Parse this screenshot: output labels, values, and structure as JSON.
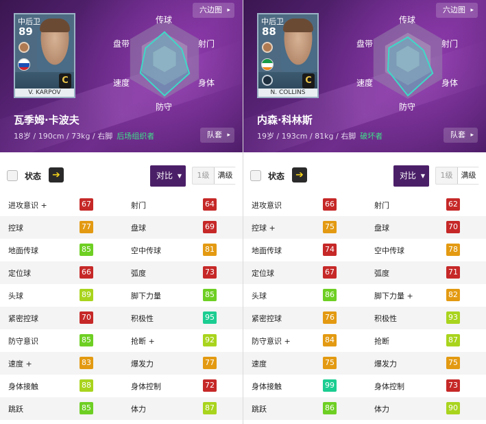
{
  "colors": {
    "red": "#c62828",
    "orange": "#e39a12",
    "yellowgreen": "#a9d41d",
    "green": "#6ecf23",
    "teal": "#1ccd92"
  },
  "players": [
    {
      "card": {
        "position": "中后卫",
        "rating": "89",
        "nameplate": "V. KARPOV",
        "grade": "C"
      },
      "name": "瓦季姆·卡波夫",
      "info": "18岁 / 190cm / 73kg / 右脚",
      "style": "后场组织者",
      "buttons": {
        "hexagon": "六边图",
        "team": "队套"
      },
      "radar_labels": {
        "passing": "传球",
        "shooting": "射门",
        "physical": "身体",
        "defense": "防守",
        "speed": "速度",
        "dribbling": "盘带"
      },
      "radar_values": {
        "passing": 0.68,
        "shooting": 0.5,
        "physical": 0.72,
        "defense": 0.92,
        "speed": 0.7,
        "dribbling": 0.55
      },
      "state": {
        "title": "状态",
        "compare": "对比",
        "level1": "1级",
        "levelmax": "满级"
      },
      "stats": [
        {
          "left_label": "进攻意识 +",
          "left_value": "67",
          "left_color": "red",
          "right_label": "射门",
          "right_value": "64",
          "right_color": "red"
        },
        {
          "left_label": "控球",
          "left_value": "77",
          "left_color": "orange",
          "right_label": "盘球",
          "right_value": "69",
          "right_color": "red"
        },
        {
          "left_label": "地面传球",
          "left_value": "85",
          "left_color": "green",
          "right_label": "空中传球",
          "right_value": "81",
          "right_color": "orange"
        },
        {
          "left_label": "定位球",
          "left_value": "66",
          "left_color": "red",
          "right_label": "弧度",
          "right_value": "73",
          "right_color": "red"
        },
        {
          "left_label": "头球",
          "left_value": "89",
          "left_color": "yellowgreen",
          "right_label": "脚下力量",
          "right_value": "85",
          "right_color": "green"
        },
        {
          "left_label": "紧密控球",
          "left_value": "70",
          "left_color": "red",
          "right_label": "积极性",
          "right_value": "95",
          "right_color": "teal"
        },
        {
          "left_label": "防守意识",
          "left_value": "85",
          "left_color": "green",
          "right_label": "抢断 +",
          "right_value": "92",
          "right_color": "yellowgreen"
        },
        {
          "left_label": "速度 +",
          "left_value": "83",
          "left_color": "orange",
          "right_label": "爆发力",
          "right_value": "77",
          "right_color": "orange"
        },
        {
          "left_label": "身体接触",
          "left_value": "88",
          "left_color": "yellowgreen",
          "right_label": "身体控制",
          "right_value": "72",
          "right_color": "red"
        },
        {
          "left_label": "跳跃",
          "left_value": "85",
          "left_color": "green",
          "right_label": "体力",
          "right_value": "87",
          "right_color": "yellowgreen"
        }
      ]
    },
    {
      "card": {
        "position": "中后卫",
        "rating": "88",
        "nameplate": "N. COLLINS",
        "grade": "C"
      },
      "name": "内森·科林斯",
      "info": "19岁 / 193cm / 81kg / 右脚",
      "style": "破坏者",
      "buttons": {
        "hexagon": "六边图",
        "team": "队套"
      },
      "radar_labels": {
        "passing": "传球",
        "shooting": "射门",
        "physical": "身体",
        "defense": "防守",
        "speed": "速度",
        "dribbling": "盘带"
      },
      "radar_values": {
        "passing": 0.55,
        "shooting": 0.45,
        "physical": 0.72,
        "defense": 0.92,
        "speed": 0.58,
        "dribbling": 0.55
      },
      "state": {
        "title": "状态",
        "compare": "对比",
        "level1": "1级",
        "levelmax": "满级"
      },
      "stats": [
        {
          "left_label": "进攻意识",
          "left_value": "66",
          "left_color": "red",
          "right_label": "射门",
          "right_value": "62",
          "right_color": "red"
        },
        {
          "left_label": "控球 +",
          "left_value": "75",
          "left_color": "orange",
          "right_label": "盘球",
          "right_value": "70",
          "right_color": "red"
        },
        {
          "left_label": "地面传球",
          "left_value": "74",
          "left_color": "red",
          "right_label": "空中传球",
          "right_value": "78",
          "right_color": "orange"
        },
        {
          "left_label": "定位球",
          "left_value": "67",
          "left_color": "red",
          "right_label": "弧度",
          "right_value": "71",
          "right_color": "red"
        },
        {
          "left_label": "头球",
          "left_value": "86",
          "left_color": "green",
          "right_label": "脚下力量 +",
          "right_value": "82",
          "right_color": "orange"
        },
        {
          "left_label": "紧密控球",
          "left_value": "76",
          "left_color": "orange",
          "right_label": "积极性",
          "right_value": "93",
          "right_color": "yellowgreen"
        },
        {
          "left_label": "防守意识 +",
          "left_value": "84",
          "left_color": "orange",
          "right_label": "抢断",
          "right_value": "87",
          "right_color": "yellowgreen"
        },
        {
          "left_label": "速度",
          "left_value": "75",
          "left_color": "orange",
          "right_label": "爆发力",
          "right_value": "75",
          "right_color": "orange"
        },
        {
          "left_label": "身体接触",
          "left_value": "99",
          "left_color": "teal",
          "right_label": "身体控制",
          "right_value": "73",
          "right_color": "red"
        },
        {
          "left_label": "跳跃",
          "left_value": "86",
          "left_color": "green",
          "right_label": "体力",
          "right_value": "90",
          "right_color": "yellowgreen"
        }
      ]
    }
  ]
}
